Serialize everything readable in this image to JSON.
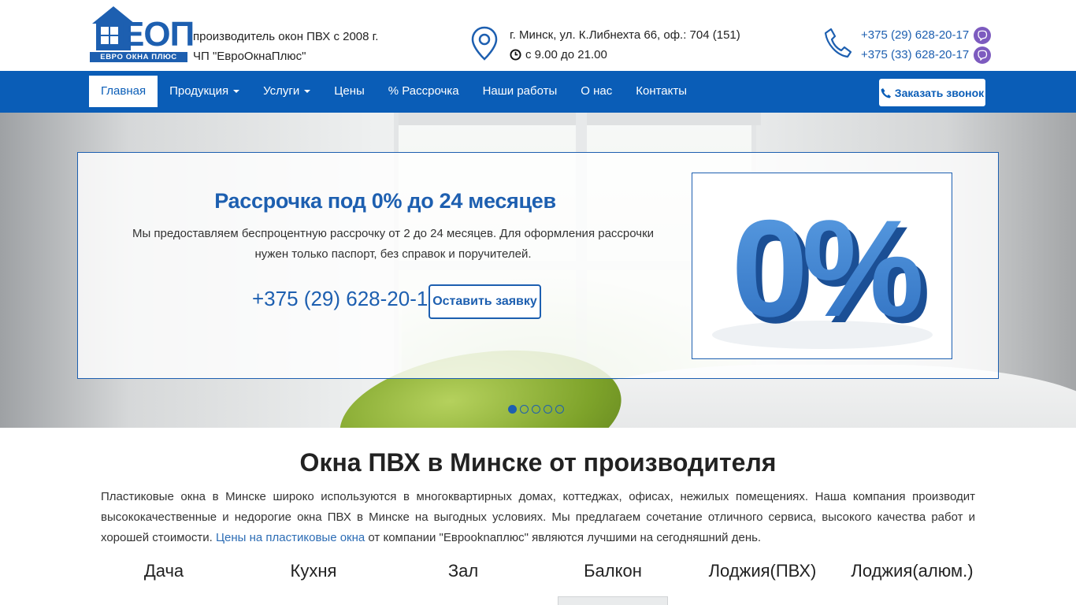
{
  "header": {
    "logo": {
      "letters": "ЕОП",
      "subtitle": "ЕВРО ОКНА ПЛЮС"
    },
    "tagline_line1": "производитель окон ПВХ с 2008 г.",
    "tagline_line2": "ЧП \"ЕвроОкнаПлюс\"",
    "address": "г. Минск, ул. К.Либнехта 66, оф.: 704 (151)",
    "hours": "с 9.00 до 21.00",
    "phones": [
      "+375 (29) 628-20-17",
      "+375 (33) 628-20-17"
    ]
  },
  "nav": {
    "items": [
      {
        "label": "Главная",
        "active": true,
        "dropdown": false
      },
      {
        "label": "Продукция",
        "active": false,
        "dropdown": true
      },
      {
        "label": "Услуги",
        "active": false,
        "dropdown": true
      },
      {
        "label": "Цены",
        "active": false,
        "dropdown": false
      },
      {
        "label": "% Рассрочка",
        "active": false,
        "dropdown": false
      },
      {
        "label": "Наши работы",
        "active": false,
        "dropdown": false
      },
      {
        "label": "О нас",
        "active": false,
        "dropdown": false
      },
      {
        "label": "Контакты",
        "active": false,
        "dropdown": false
      }
    ],
    "call_button": "Заказать звонок"
  },
  "hero": {
    "title": "Рассрочка под 0% до 24 месяцев",
    "text": "Мы предоставляем беспроцентную рассрочку от 2 до 24 месяцев. Для оформления рассрочки нужен только паспорт, без справок и поручителей.",
    "phone": "+375 (29) 628-20-17",
    "button": "Оставить заявку",
    "image_text": "0%",
    "slides_total": 5,
    "slide_active": 1
  },
  "main": {
    "title": "Окна ПВХ в Минске от производителя",
    "intro_before_link": "Пластиковые окна в Минске широко используются в многоквартирных домах, коттеджах, офисах, нежилых помещениях. Наша компания производит высококачественные и недорогие окна ПВХ в Минске на выгодных условиях. Мы предлагаем сочетание отличного сервиса, высокого качества работ и хорошей стоимости. ",
    "intro_link": "Цены на пластиковые окна",
    "intro_after_link": " от компании \"Еврооknaплюс\" являются лучшими на сегодняшний день.",
    "categories": [
      "Дача",
      "Кухня",
      "Зал",
      "Балкон",
      "Лоджия(ПВХ)",
      "Лоджия(алюм.)"
    ]
  },
  "colors": {
    "brand": "#0a5db7",
    "accent": "#1d5fb0",
    "viber": "#7d5bbf"
  }
}
